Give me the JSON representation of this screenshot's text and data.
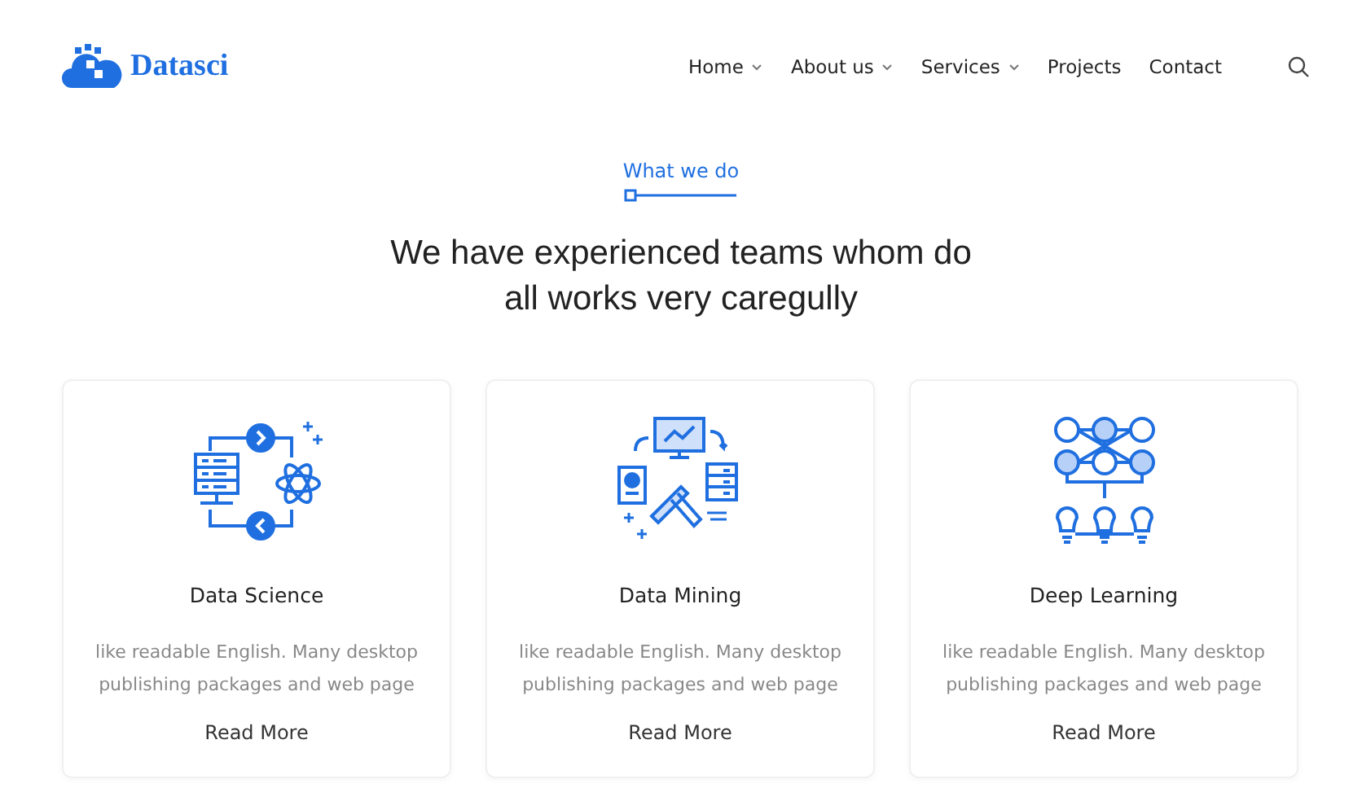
{
  "logo": {
    "text": "Datasci"
  },
  "nav": [
    {
      "label": "Home",
      "dropdown": true
    },
    {
      "label": "About us",
      "dropdown": true
    },
    {
      "label": "Services",
      "dropdown": true
    },
    {
      "label": "Projects",
      "dropdown": false
    },
    {
      "label": "Contact",
      "dropdown": false
    }
  ],
  "section": {
    "eyebrow": "What we do",
    "heading_lines": [
      "We have experienced teams whom do",
      "all works very caregully"
    ]
  },
  "cards": [
    {
      "kind": "science",
      "title": "Data Science",
      "text": "like readable English. Many desktop publishing packages and web page",
      "link": "Read More"
    },
    {
      "kind": "mining",
      "title": "Data Mining",
      "text": "like readable English. Many desktop publishing packages and web page",
      "link": "Read More"
    },
    {
      "kind": "learning",
      "title": "Deep Learning",
      "text": "like readable English. Many desktop publishing packages and web page",
      "link": "Read More"
    }
  ]
}
